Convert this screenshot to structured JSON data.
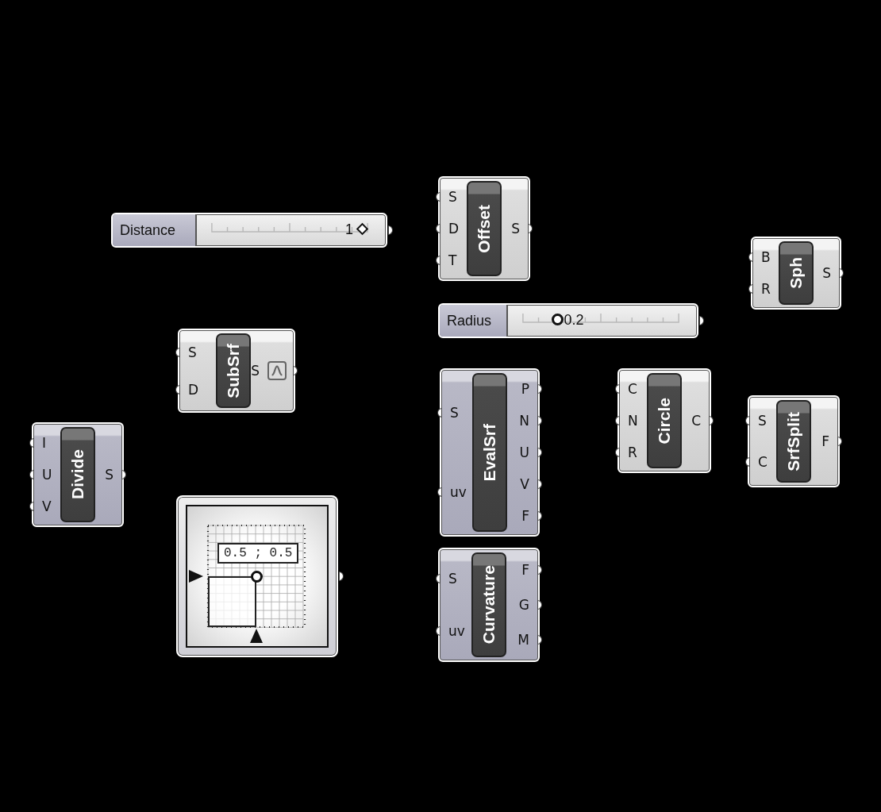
{
  "canvas": {
    "items": [
      {
        "kind": "slider",
        "label": "Distance",
        "integer": true,
        "value": "1"
      },
      {
        "kind": "component",
        "name": "Offset",
        "preview": true,
        "inputs": [
          "S",
          "D",
          "T"
        ],
        "outputs": [
          "S"
        ]
      },
      {
        "kind": "component",
        "name": "Sph",
        "preview": true,
        "inputs": [
          "B",
          "R"
        ],
        "outputs": [
          "S"
        ]
      },
      {
        "kind": "slider",
        "label": "Radius",
        "integer": false,
        "value": "0.2"
      },
      {
        "kind": "component",
        "name": "SubSrf",
        "preview": true,
        "inputs": [
          "S",
          "D"
        ],
        "outputs": [
          "S"
        ],
        "display_icon": true
      },
      {
        "kind": "component",
        "name": "EvalSrf",
        "preview": false,
        "inputs": [
          "S",
          "uv"
        ],
        "outputs": [
          "P",
          "N",
          "U",
          "V",
          "F"
        ]
      },
      {
        "kind": "component",
        "name": "Circle",
        "preview": true,
        "inputs": [
          "C",
          "N",
          "R"
        ],
        "outputs": [
          "C"
        ]
      },
      {
        "kind": "component",
        "name": "SrfSplit",
        "preview": true,
        "inputs": [
          "S",
          "C"
        ],
        "outputs": [
          "F"
        ]
      },
      {
        "kind": "component",
        "name": "Divide",
        "preview": false,
        "inputs": [
          "I",
          "U",
          "V"
        ],
        "outputs": [
          "S"
        ]
      },
      {
        "kind": "mdslider",
        "value": "0.5 ; 0.5"
      },
      {
        "kind": "component",
        "name": "Curvature",
        "preview": false,
        "inputs": [
          "S",
          "uv"
        ],
        "outputs": [
          "F",
          "G",
          "M"
        ]
      }
    ]
  }
}
